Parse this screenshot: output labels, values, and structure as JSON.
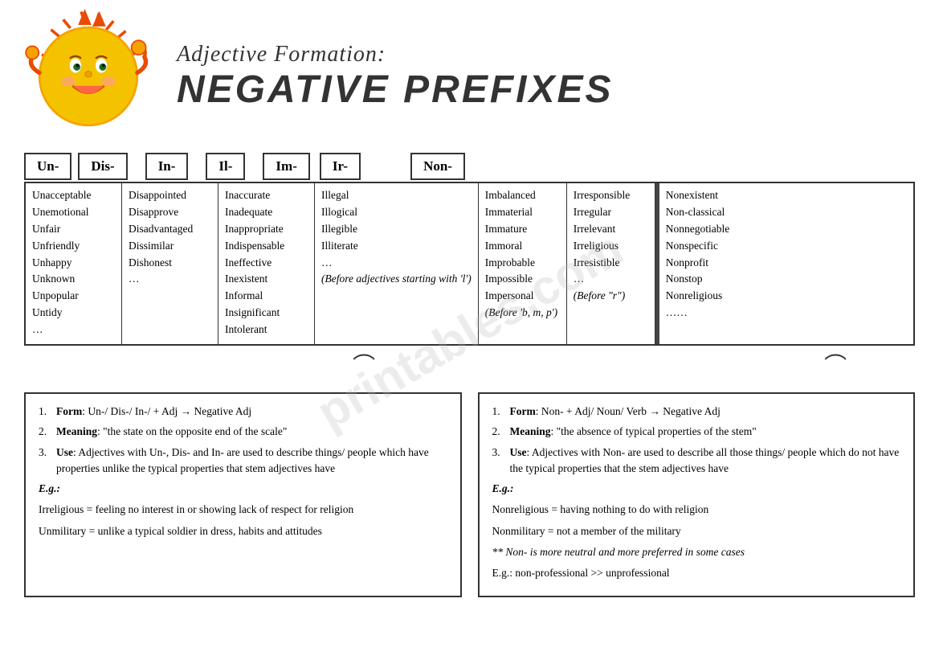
{
  "header": {
    "subtitle": "Adjective Formation:",
    "main_title": "NEGATIVE PREFIXES"
  },
  "prefixes": {
    "un": {
      "label": "Un-",
      "words": [
        "Unacceptable",
        "Unemotional",
        "Unfair",
        "Unfriendly",
        "Unhappy",
        "Unknown",
        "Unpopular",
        "Untidy",
        "…"
      ]
    },
    "dis": {
      "label": "Dis-",
      "words": [
        "Disappointed",
        "Disapprove",
        "Disadvantaged",
        "Dissimilar",
        "Dishonest",
        "…"
      ]
    },
    "in": {
      "label": "In-",
      "words": [
        "Inaccurate",
        "Inadequate",
        "Inappropriate",
        "Indispensable",
        "Ineffective",
        "Inexistent",
        "Informal",
        "Insignificant",
        "Intolerant"
      ]
    },
    "il": {
      "label": "Il-",
      "words": [
        "Illegal",
        "Illogical",
        "Illegible",
        "Illiterate",
        "…",
        "(Before adjectives starting with 'l')"
      ],
      "note": "(Before adjectives starting with 'l')"
    },
    "im": {
      "label": "Im-",
      "words": [
        "Imbalanced",
        "Immaterial",
        "Immature",
        "Immoral",
        "Improbable",
        "Impossible",
        "Impersonal"
      ],
      "note": "(Before 'b, m, p')"
    },
    "ir": {
      "label": "Ir-",
      "words": [
        "Irresponsible",
        "Irregular",
        "Irrelevant",
        "Irreligious",
        "Irresistible",
        "…"
      ],
      "note": "(Before \"r\")"
    },
    "non": {
      "label": "Non-",
      "words": [
        "Nonexistent",
        "Non-classical",
        "Nonnegotiable",
        "Nonspecific",
        "Nonprofit",
        "Nonstop",
        "Nonreligious",
        "……"
      ]
    }
  },
  "info_left": {
    "items": [
      {
        "num": "1.",
        "bold": "Form",
        "text": ": Un-/ Dis-/ In-/ + Adj → Negative Adj"
      },
      {
        "num": "2.",
        "bold": "Meaning",
        "text": ": \"the state on the opposite end of the scale\""
      },
      {
        "num": "3.",
        "bold": "Use",
        "text": ": Adjectives with Un-, Dis- and In- are used to describe things/ people which have properties unlike the typical properties that stem adjectives have"
      }
    ],
    "eg_label": "E.g.:",
    "examples": [
      "Irreligious = feeling no interest in or showing lack of respect for religion",
      "Unmilitary = unlike a typical soldier in dress, habits and attitudes"
    ]
  },
  "info_right": {
    "items": [
      {
        "num": "1.",
        "bold": "Form",
        "text": ": Non- + Adj/ Noun/ Verb → Negative Adj"
      },
      {
        "num": "2.",
        "bold": "Meaning",
        "text": ": \"the absence of typical properties of the stem\""
      },
      {
        "num": "3.",
        "bold": "Use",
        "text": ": Adjectives with Non- are used to describe all those things/ people which do not have the typical properties that the stem adjectives have"
      }
    ],
    "eg_label": "E.g.:",
    "examples": [
      "Nonreligious = having nothing to do with religion",
      "Nonmilitary = not a member of the military"
    ],
    "note_italic": "** Non- is more neutral and more preferred in some cases",
    "extra_eg": "E.g.: non-professional >> unprofessional"
  }
}
